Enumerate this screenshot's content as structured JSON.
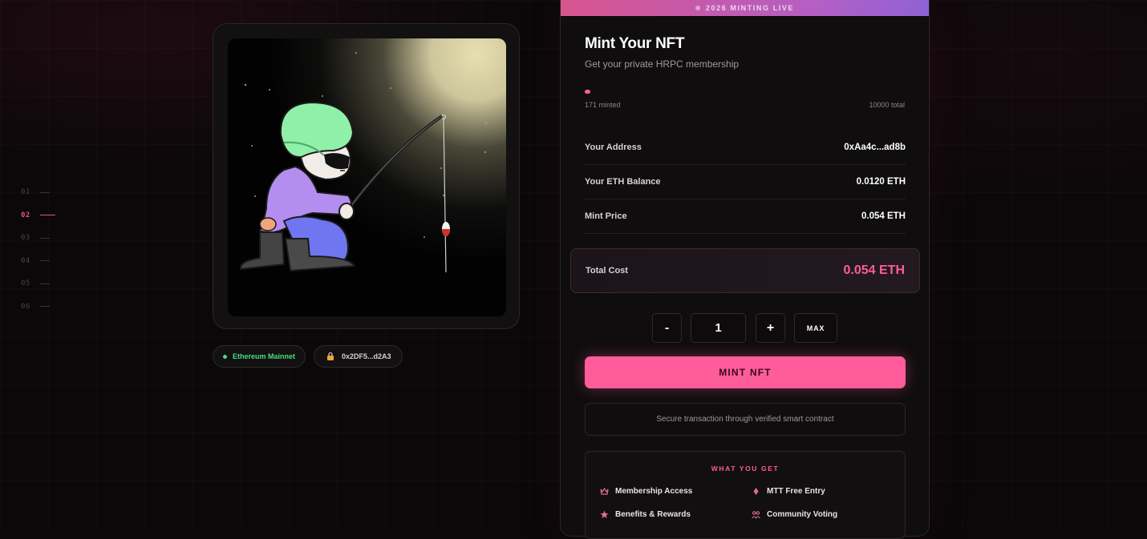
{
  "section_nav": {
    "items": [
      {
        "label": "01",
        "active": false
      },
      {
        "label": "02",
        "active": true
      },
      {
        "label": "03",
        "active": false
      },
      {
        "label": "04",
        "active": false
      },
      {
        "label": "05",
        "active": false
      },
      {
        "label": "06",
        "active": false
      }
    ]
  },
  "artwork": {
    "icon": "fishing-character-illustration"
  },
  "network_badge": {
    "label": "Ethereum Mainnet",
    "color": "#4ade80"
  },
  "contract_badge": {
    "label": "0x2DF5...d2A3",
    "icon": "lock-icon"
  },
  "mint": {
    "banner": "2026 MINTING LIVE",
    "title": "Mint Your NFT",
    "subtitle": "Get your private HRPC membership",
    "progress_fraction": 0.0171,
    "minted_label": "171 minted",
    "total_label": "10000 total",
    "rows": {
      "address_label": "Your Address",
      "address_value": "0xAa4c...ad8b",
      "balance_label": "Your ETH Balance",
      "balance_value": "0.0120 ETH",
      "price_label": "Mint Price",
      "price_value": "0.054 ETH"
    },
    "total_cost_label": "Total Cost",
    "total_cost_value": "0.054 ETH",
    "quantity": {
      "minus": "-",
      "value": "1",
      "plus": "+",
      "max": "MAX"
    },
    "mint_button": "MINT NFT",
    "secure_note": "Secure transaction through verified smart contract",
    "benefits": {
      "title": "WHAT YOU GET",
      "items": [
        {
          "label": "Membership Access",
          "icon": "crown-icon"
        },
        {
          "label": "MTT Free Entry",
          "icon": "diamond-icon"
        },
        {
          "label": "Benefits & Rewards",
          "icon": "star-icon"
        },
        {
          "label": "Community Voting",
          "icon": "vote-icon"
        }
      ]
    }
  },
  "colors": {
    "accent": "#ff5c9b",
    "background": "#0a0809",
    "success": "#4ade80"
  }
}
